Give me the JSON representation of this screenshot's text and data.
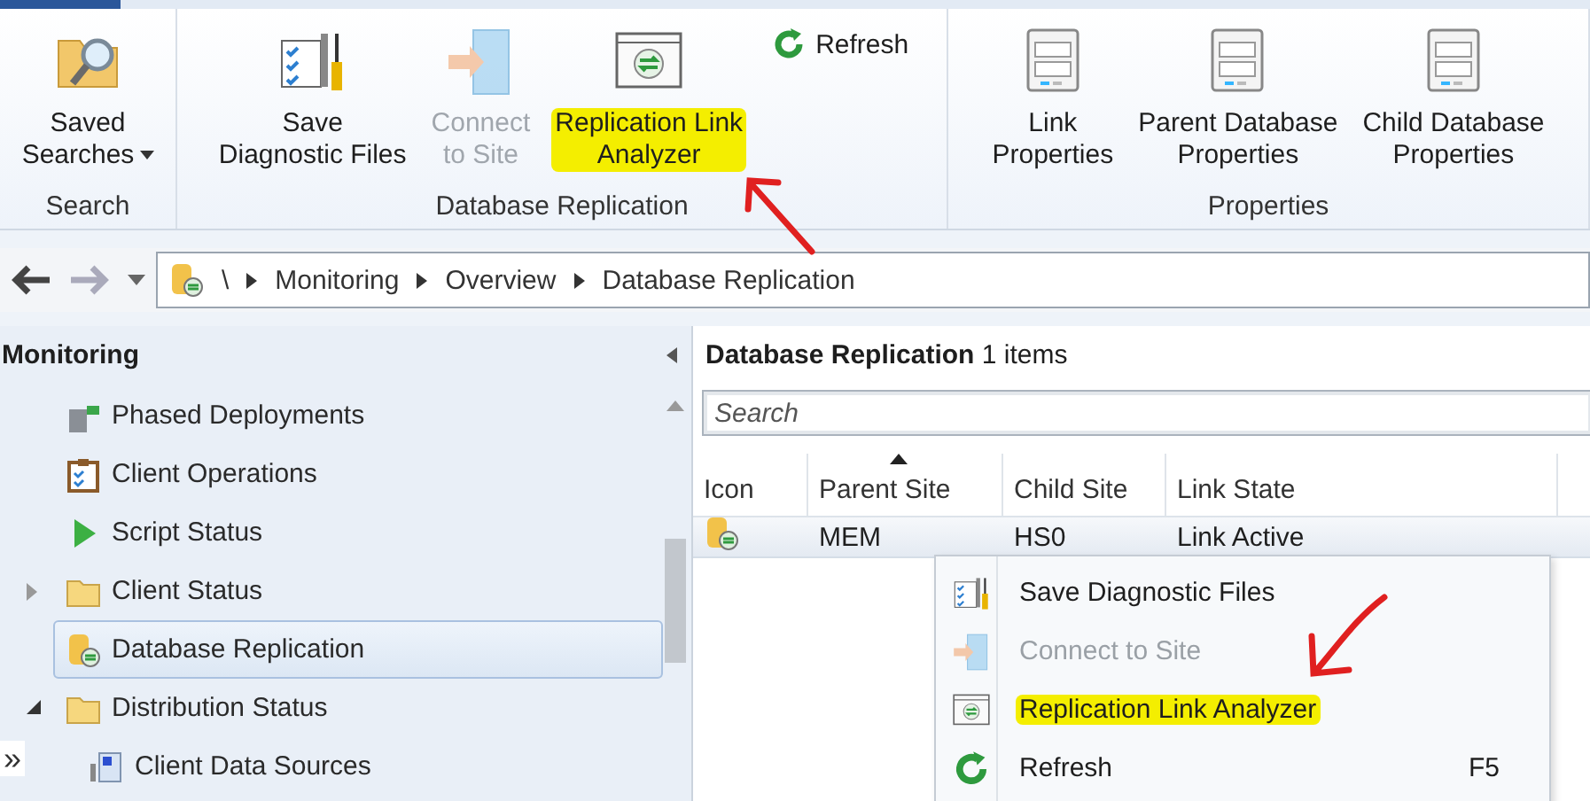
{
  "ribbon": {
    "groups": [
      {
        "label": "Search",
        "buttons": [
          {
            "kind": "saved-searches",
            "label": [
              "Saved",
              "Searches"
            ],
            "dropdown": true,
            "disabled": false,
            "highlighted": false
          }
        ]
      },
      {
        "label": "Database Replication",
        "buttons": [
          {
            "kind": "diagnostic",
            "label": [
              "Save",
              "Diagnostic Files"
            ],
            "dropdown": false,
            "disabled": false,
            "highlighted": false
          },
          {
            "kind": "connect",
            "label": [
              "Connect",
              "to Site"
            ],
            "dropdown": false,
            "disabled": true,
            "highlighted": false
          },
          {
            "kind": "analyzer",
            "label": [
              "Replication Link",
              "Analyzer"
            ],
            "dropdown": false,
            "disabled": false,
            "highlighted": true
          },
          {
            "kind": "refresh",
            "label": [
              "Refresh"
            ]
          }
        ]
      },
      {
        "label": "Properties",
        "buttons": [
          {
            "kind": "properties",
            "label": [
              "Link",
              "Properties"
            ],
            "dropdown": false,
            "disabled": false,
            "highlighted": false
          },
          {
            "kind": "properties",
            "label": [
              "Parent Database",
              "Properties"
            ],
            "dropdown": false,
            "disabled": false,
            "highlighted": false
          },
          {
            "kind": "properties",
            "label": [
              "Child Database",
              "Properties"
            ],
            "dropdown": false,
            "disabled": false,
            "highlighted": false
          }
        ]
      }
    ]
  },
  "breadcrumb": {
    "root": "\\",
    "items": [
      "Monitoring",
      "Overview",
      "Database Replication"
    ]
  },
  "navigation_pane": {
    "title": "Monitoring",
    "tree": [
      {
        "label": "Phased Deployments",
        "kind": "deployment"
      },
      {
        "label": "Client Operations",
        "kind": "operations"
      },
      {
        "label": "Script Status",
        "kind": "script"
      },
      {
        "label": "Client Status",
        "kind": "folder",
        "expanded": false
      },
      {
        "label": "Database Replication",
        "kind": "replication",
        "selected": true
      },
      {
        "label": "Distribution Status",
        "kind": "folder",
        "expanded": true,
        "children": [
          {
            "label": "Client Data Sources",
            "kind": "datasource"
          }
        ]
      }
    ],
    "overflow_button": "»"
  },
  "content": {
    "title": "Database Replication",
    "count": "1 items",
    "search": {
      "placeholder": "Search"
    },
    "table": {
      "columns": [
        {
          "label": "Icon",
          "sorted": false
        },
        {
          "label": "Parent Site",
          "sorted": true
        },
        {
          "label": "Child Site",
          "sorted": false
        },
        {
          "label": "Link State",
          "sorted": false
        }
      ],
      "rows": [
        {
          "parent_site": "MEM",
          "child_site": "HS0",
          "link_state": "Link Active"
        }
      ]
    }
  },
  "context_menu": {
    "items": [
      {
        "kind": "diagnostic",
        "label": "Save Diagnostic Files",
        "disabled": false,
        "highlighted": false
      },
      {
        "kind": "connect",
        "label": "Connect to Site",
        "disabled": true,
        "highlighted": false
      },
      {
        "kind": "analyzer",
        "label": "Replication Link Analyzer",
        "disabled": false,
        "highlighted": true
      },
      {
        "kind": "refresh",
        "label": "Refresh",
        "shortcut": "F5",
        "disabled": false,
        "highlighted": false
      }
    ]
  }
}
